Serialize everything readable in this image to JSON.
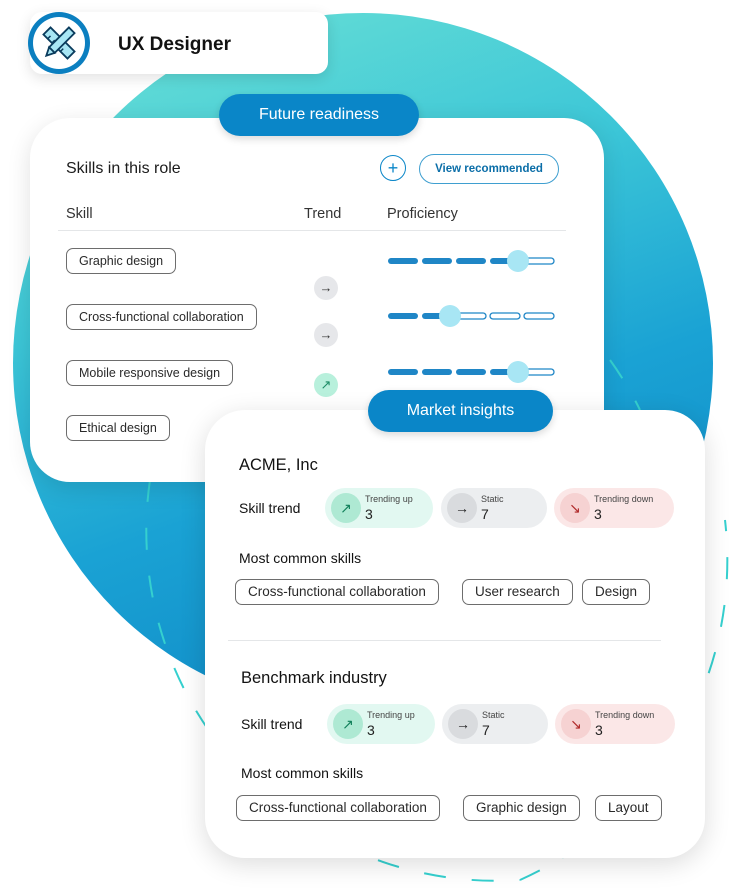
{
  "role": {
    "title": "UX Designer",
    "icon": "ruler-pencil-icon"
  },
  "skills_panel": {
    "tab_label": "Future readiness",
    "title": "Skills in this role",
    "add_symbol": "+",
    "view_recommended": "View recommended",
    "columns": {
      "skill": "Skill",
      "trend": "Trend",
      "proficiency": "Proficiency"
    },
    "skills": [
      {
        "name": "Graphic design",
        "trend": "static",
        "proficiency_level": 4,
        "proficiency_max": 5
      },
      {
        "name": "Cross-functional collaboration",
        "trend": "static",
        "proficiency_level": 2,
        "proficiency_max": 5
      },
      {
        "name": "Mobile responsive design",
        "trend": "up",
        "proficiency_level": 4,
        "proficiency_max": 5
      },
      {
        "name": "Ethical design",
        "trend": "",
        "proficiency_level": null,
        "proficiency_max": 5
      }
    ]
  },
  "market_panel": {
    "tab_label": "Market insights",
    "companies": [
      {
        "name": "ACME, Inc",
        "skill_trend_label": "Skill trend",
        "trends": [
          {
            "kind": "up",
            "label": "Trending up",
            "count": "3"
          },
          {
            "kind": "static",
            "label": "Static",
            "count": "7"
          },
          {
            "kind": "down",
            "label": "Trending down",
            "count": "3"
          }
        ],
        "common_label": "Most common skills",
        "common_skills": [
          "Cross-functional collaboration",
          "User research",
          "Design"
        ]
      },
      {
        "name": "Benchmark industry",
        "skill_trend_label": "Skill trend",
        "trends": [
          {
            "kind": "up",
            "label": "Trending up",
            "count": "3"
          },
          {
            "kind": "static",
            "label": "Static",
            "count": "7"
          },
          {
            "kind": "down",
            "label": "Trending down",
            "count": "3"
          }
        ],
        "common_label": "Most common skills",
        "common_skills": [
          "Cross-functional collaboration",
          "Graphic design",
          "Layout"
        ]
      }
    ]
  },
  "colors": {
    "accent": "#0a86c8",
    "slider": "#1f86c6",
    "thumb": "#a8e6f4",
    "up": "#11805a",
    "down": "#b02a2a"
  }
}
